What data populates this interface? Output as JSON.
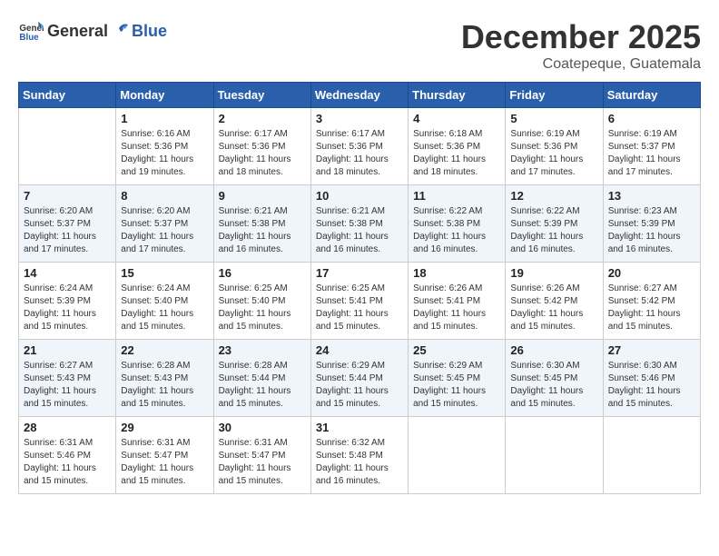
{
  "header": {
    "logo_general": "General",
    "logo_blue": "Blue",
    "month": "December 2025",
    "location": "Coatepeque, Guatemala"
  },
  "days_of_week": [
    "Sunday",
    "Monday",
    "Tuesday",
    "Wednesday",
    "Thursday",
    "Friday",
    "Saturday"
  ],
  "weeks": [
    [
      {
        "day": "",
        "sunrise": "",
        "sunset": "",
        "daylight": ""
      },
      {
        "day": "1",
        "sunrise": "Sunrise: 6:16 AM",
        "sunset": "Sunset: 5:36 PM",
        "daylight": "Daylight: 11 hours and 19 minutes."
      },
      {
        "day": "2",
        "sunrise": "Sunrise: 6:17 AM",
        "sunset": "Sunset: 5:36 PM",
        "daylight": "Daylight: 11 hours and 18 minutes."
      },
      {
        "day": "3",
        "sunrise": "Sunrise: 6:17 AM",
        "sunset": "Sunset: 5:36 PM",
        "daylight": "Daylight: 11 hours and 18 minutes."
      },
      {
        "day": "4",
        "sunrise": "Sunrise: 6:18 AM",
        "sunset": "Sunset: 5:36 PM",
        "daylight": "Daylight: 11 hours and 18 minutes."
      },
      {
        "day": "5",
        "sunrise": "Sunrise: 6:19 AM",
        "sunset": "Sunset: 5:36 PM",
        "daylight": "Daylight: 11 hours and 17 minutes."
      },
      {
        "day": "6",
        "sunrise": "Sunrise: 6:19 AM",
        "sunset": "Sunset: 5:37 PM",
        "daylight": "Daylight: 11 hours and 17 minutes."
      }
    ],
    [
      {
        "day": "7",
        "sunrise": "Sunrise: 6:20 AM",
        "sunset": "Sunset: 5:37 PM",
        "daylight": "Daylight: 11 hours and 17 minutes."
      },
      {
        "day": "8",
        "sunrise": "Sunrise: 6:20 AM",
        "sunset": "Sunset: 5:37 PM",
        "daylight": "Daylight: 11 hours and 17 minutes."
      },
      {
        "day": "9",
        "sunrise": "Sunrise: 6:21 AM",
        "sunset": "Sunset: 5:38 PM",
        "daylight": "Daylight: 11 hours and 16 minutes."
      },
      {
        "day": "10",
        "sunrise": "Sunrise: 6:21 AM",
        "sunset": "Sunset: 5:38 PM",
        "daylight": "Daylight: 11 hours and 16 minutes."
      },
      {
        "day": "11",
        "sunrise": "Sunrise: 6:22 AM",
        "sunset": "Sunset: 5:38 PM",
        "daylight": "Daylight: 11 hours and 16 minutes."
      },
      {
        "day": "12",
        "sunrise": "Sunrise: 6:22 AM",
        "sunset": "Sunset: 5:39 PM",
        "daylight": "Daylight: 11 hours and 16 minutes."
      },
      {
        "day": "13",
        "sunrise": "Sunrise: 6:23 AM",
        "sunset": "Sunset: 5:39 PM",
        "daylight": "Daylight: 11 hours and 16 minutes."
      }
    ],
    [
      {
        "day": "14",
        "sunrise": "Sunrise: 6:24 AM",
        "sunset": "Sunset: 5:39 PM",
        "daylight": "Daylight: 11 hours and 15 minutes."
      },
      {
        "day": "15",
        "sunrise": "Sunrise: 6:24 AM",
        "sunset": "Sunset: 5:40 PM",
        "daylight": "Daylight: 11 hours and 15 minutes."
      },
      {
        "day": "16",
        "sunrise": "Sunrise: 6:25 AM",
        "sunset": "Sunset: 5:40 PM",
        "daylight": "Daylight: 11 hours and 15 minutes."
      },
      {
        "day": "17",
        "sunrise": "Sunrise: 6:25 AM",
        "sunset": "Sunset: 5:41 PM",
        "daylight": "Daylight: 11 hours and 15 minutes."
      },
      {
        "day": "18",
        "sunrise": "Sunrise: 6:26 AM",
        "sunset": "Sunset: 5:41 PM",
        "daylight": "Daylight: 11 hours and 15 minutes."
      },
      {
        "day": "19",
        "sunrise": "Sunrise: 6:26 AM",
        "sunset": "Sunset: 5:42 PM",
        "daylight": "Daylight: 11 hours and 15 minutes."
      },
      {
        "day": "20",
        "sunrise": "Sunrise: 6:27 AM",
        "sunset": "Sunset: 5:42 PM",
        "daylight": "Daylight: 11 hours and 15 minutes."
      }
    ],
    [
      {
        "day": "21",
        "sunrise": "Sunrise: 6:27 AM",
        "sunset": "Sunset: 5:43 PM",
        "daylight": "Daylight: 11 hours and 15 minutes."
      },
      {
        "day": "22",
        "sunrise": "Sunrise: 6:28 AM",
        "sunset": "Sunset: 5:43 PM",
        "daylight": "Daylight: 11 hours and 15 minutes."
      },
      {
        "day": "23",
        "sunrise": "Sunrise: 6:28 AM",
        "sunset": "Sunset: 5:44 PM",
        "daylight": "Daylight: 11 hours and 15 minutes."
      },
      {
        "day": "24",
        "sunrise": "Sunrise: 6:29 AM",
        "sunset": "Sunset: 5:44 PM",
        "daylight": "Daylight: 11 hours and 15 minutes."
      },
      {
        "day": "25",
        "sunrise": "Sunrise: 6:29 AM",
        "sunset": "Sunset: 5:45 PM",
        "daylight": "Daylight: 11 hours and 15 minutes."
      },
      {
        "day": "26",
        "sunrise": "Sunrise: 6:30 AM",
        "sunset": "Sunset: 5:45 PM",
        "daylight": "Daylight: 11 hours and 15 minutes."
      },
      {
        "day": "27",
        "sunrise": "Sunrise: 6:30 AM",
        "sunset": "Sunset: 5:46 PM",
        "daylight": "Daylight: 11 hours and 15 minutes."
      }
    ],
    [
      {
        "day": "28",
        "sunrise": "Sunrise: 6:31 AM",
        "sunset": "Sunset: 5:46 PM",
        "daylight": "Daylight: 11 hours and 15 minutes."
      },
      {
        "day": "29",
        "sunrise": "Sunrise: 6:31 AM",
        "sunset": "Sunset: 5:47 PM",
        "daylight": "Daylight: 11 hours and 15 minutes."
      },
      {
        "day": "30",
        "sunrise": "Sunrise: 6:31 AM",
        "sunset": "Sunset: 5:47 PM",
        "daylight": "Daylight: 11 hours and 15 minutes."
      },
      {
        "day": "31",
        "sunrise": "Sunrise: 6:32 AM",
        "sunset": "Sunset: 5:48 PM",
        "daylight": "Daylight: 11 hours and 16 minutes."
      },
      {
        "day": "",
        "sunrise": "",
        "sunset": "",
        "daylight": ""
      },
      {
        "day": "",
        "sunrise": "",
        "sunset": "",
        "daylight": ""
      },
      {
        "day": "",
        "sunrise": "",
        "sunset": "",
        "daylight": ""
      }
    ]
  ]
}
